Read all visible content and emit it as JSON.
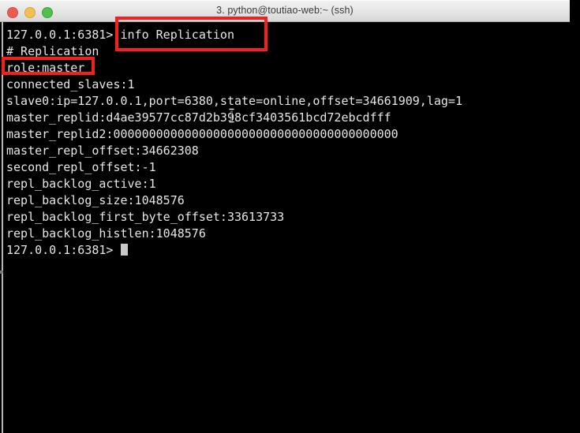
{
  "window": {
    "title": "3. python@toutiao-web:~ (ssh)",
    "traffic_lights": [
      {
        "name": "close",
        "color": "#f05b51"
      },
      {
        "name": "minimize",
        "color": "#f5bf4f"
      },
      {
        "name": "maximize",
        "color": "#51c14c"
      }
    ]
  },
  "terminal": {
    "prompt": "127.0.0.1:6381>",
    "lines": [
      "127.0.0.1:6381> info Replication",
      "# Replication",
      "role:master",
      "connected_slaves:1",
      "slave0:ip=127.0.0.1,port=6380,state=online,offset=34661909,lag=1",
      "master_replid:d4ae39577cc87d2b398cf3403561bcd72ebcdfff",
      "master_replid2:0000000000000000000000000000000000000000",
      "master_repl_offset:34662308",
      "second_repl_offset:-1",
      "repl_backlog_active:1",
      "repl_backlog_size:1048576",
      "repl_backlog_first_byte_offset:33613733",
      "repl_backlog_histlen:1048576"
    ],
    "last_prompt": "127.0.0.1:6381> ",
    "command": "info Replication"
  },
  "annotations": {
    "color": "#f41f1f",
    "boxes": [
      {
        "name": "command-highlight",
        "target": "info Replication"
      },
      {
        "name": "role-highlight",
        "target": "role:master"
      }
    ]
  }
}
